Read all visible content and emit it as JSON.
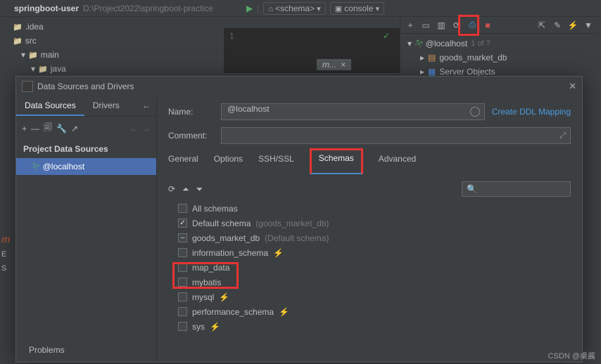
{
  "project": {
    "name": "springboot-user",
    "path": "D:\\Project2022\\springboot-practice"
  },
  "tree": {
    "idea": ".idea",
    "src": "src",
    "main": "main",
    "java": "java"
  },
  "runbar": {
    "schema": "<schema>",
    "console": "console"
  },
  "editor": {
    "lineno": "1",
    "tab": "m...",
    "close": "×"
  },
  "database": {
    "localhost": "@localhost",
    "count": "1 of 7",
    "items": [
      "goods_market_db",
      "Server Objects"
    ]
  },
  "dialog": {
    "title": "Data Sources and Drivers",
    "tabs": {
      "ds": "Data Sources",
      "drivers": "Drivers"
    },
    "section": "Project Data Sources",
    "ds_item": "@localhost",
    "problems": "Problems",
    "name_label": "Name:",
    "comment_label": "Comment:",
    "name_value": "@localhost",
    "link": "Create DDL Mapping",
    "rtabs": {
      "general": "General",
      "options": "Options",
      "ssh": "SSH/SSL",
      "schemas": "Schemas",
      "advanced": "Advanced"
    },
    "schemas": {
      "all": "All schemas",
      "default": "Default schema",
      "default_hint": "(goods_market_db)",
      "gmdb": "goods_market_db",
      "gmdb_hint": "(Default schema)",
      "info": "information_schema",
      "map": "map_data",
      "mybatis": "mybatis",
      "mysql": "mysql",
      "perf": "performance_schema",
      "sys": "sys"
    }
  },
  "sidebar_stubs": [
    "m",
    "E",
    "S"
  ],
  "watermark": "CSDN @桌酱"
}
